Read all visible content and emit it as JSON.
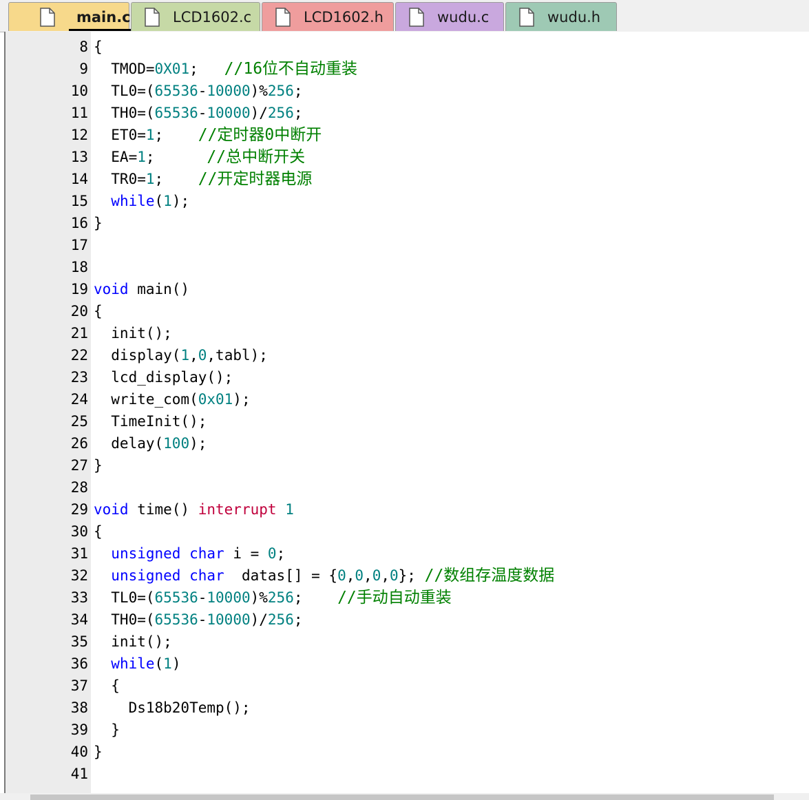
{
  "tabs": [
    {
      "label": "main.c",
      "active": true,
      "color": "#f7d98b"
    },
    {
      "label": "LCD1602.c",
      "active": false,
      "color": "#c6d9a6"
    },
    {
      "label": "LCD1602.h",
      "active": false,
      "color": "#ef9d9d"
    },
    {
      "label": "wudu.c",
      "active": false,
      "color": "#c9a8de"
    },
    {
      "label": "wudu.h",
      "active": false,
      "color": "#9ec9b4"
    }
  ],
  "tab_icon": "file-icon",
  "syntax_colors": {
    "keyword": "#0000ff",
    "number": "#008080",
    "interrupt": "#c0003c",
    "comment": "#008000",
    "text": "#000000"
  },
  "code_lines": [
    {
      "n": "8",
      "tokens": [
        {
          "t": "{"
        }
      ]
    },
    {
      "n": "9",
      "tokens": [
        {
          "t": "  TMOD="
        },
        {
          "t": "0X01",
          "c": "num"
        },
        {
          "t": ";   "
        },
        {
          "t": "//16位不自动重装",
          "c": "cm"
        }
      ]
    },
    {
      "n": "10",
      "tokens": [
        {
          "t": "  TL0=("
        },
        {
          "t": "65536",
          "c": "num"
        },
        {
          "t": "-"
        },
        {
          "t": "10000",
          "c": "num"
        },
        {
          "t": ")%"
        },
        {
          "t": "256",
          "c": "num"
        },
        {
          "t": ";"
        }
      ]
    },
    {
      "n": "11",
      "tokens": [
        {
          "t": "  TH0=("
        },
        {
          "t": "65536",
          "c": "num"
        },
        {
          "t": "-"
        },
        {
          "t": "10000",
          "c": "num"
        },
        {
          "t": ")/"
        },
        {
          "t": "256",
          "c": "num"
        },
        {
          "t": ";"
        }
      ]
    },
    {
      "n": "12",
      "tokens": [
        {
          "t": "  ET0="
        },
        {
          "t": "1",
          "c": "num"
        },
        {
          "t": ";    "
        },
        {
          "t": "//定时器0中断开",
          "c": "cm"
        }
      ]
    },
    {
      "n": "13",
      "tokens": [
        {
          "t": "  EA="
        },
        {
          "t": "1",
          "c": "num"
        },
        {
          "t": ";      "
        },
        {
          "t": "//总中断开关",
          "c": "cm"
        }
      ]
    },
    {
      "n": "14",
      "tokens": [
        {
          "t": "  TR0="
        },
        {
          "t": "1",
          "c": "num"
        },
        {
          "t": ";    "
        },
        {
          "t": "//开定时器电源",
          "c": "cm"
        }
      ]
    },
    {
      "n": "15",
      "tokens": [
        {
          "t": "  "
        },
        {
          "t": "while",
          "c": "kw"
        },
        {
          "t": "("
        },
        {
          "t": "1",
          "c": "num"
        },
        {
          "t": ");"
        }
      ]
    },
    {
      "n": "16",
      "tokens": [
        {
          "t": "}"
        }
      ]
    },
    {
      "n": "17",
      "tokens": []
    },
    {
      "n": "18",
      "tokens": []
    },
    {
      "n": "19",
      "tokens": [
        {
          "t": "void",
          "c": "kw"
        },
        {
          "t": " main()"
        }
      ]
    },
    {
      "n": "20",
      "tokens": [
        {
          "t": "{"
        }
      ]
    },
    {
      "n": "21",
      "tokens": [
        {
          "t": "  init();"
        }
      ]
    },
    {
      "n": "22",
      "tokens": [
        {
          "t": "  display("
        },
        {
          "t": "1",
          "c": "num"
        },
        {
          "t": ","
        },
        {
          "t": "0",
          "c": "num"
        },
        {
          "t": ",tabl);"
        }
      ]
    },
    {
      "n": "23",
      "tokens": [
        {
          "t": "  lcd_display();"
        }
      ]
    },
    {
      "n": "24",
      "tokens": [
        {
          "t": "  write_com("
        },
        {
          "t": "0x01",
          "c": "num"
        },
        {
          "t": ");"
        }
      ]
    },
    {
      "n": "25",
      "tokens": [
        {
          "t": "  TimeInit();"
        }
      ]
    },
    {
      "n": "26",
      "tokens": [
        {
          "t": "  delay("
        },
        {
          "t": "100",
          "c": "num"
        },
        {
          "t": ");"
        }
      ]
    },
    {
      "n": "27",
      "tokens": [
        {
          "t": "}"
        }
      ]
    },
    {
      "n": "28",
      "tokens": []
    },
    {
      "n": "29",
      "tokens": [
        {
          "t": "void",
          "c": "kw"
        },
        {
          "t": " time() "
        },
        {
          "t": "interrupt",
          "c": "int"
        },
        {
          "t": " "
        },
        {
          "t": "1",
          "c": "num"
        }
      ]
    },
    {
      "n": "30",
      "tokens": [
        {
          "t": "{"
        }
      ]
    },
    {
      "n": "31",
      "tokens": [
        {
          "t": "  "
        },
        {
          "t": "unsigned",
          "c": "kw"
        },
        {
          "t": " "
        },
        {
          "t": "char",
          "c": "kw"
        },
        {
          "t": " i = "
        },
        {
          "t": "0",
          "c": "num"
        },
        {
          "t": ";"
        }
      ]
    },
    {
      "n": "32",
      "tokens": [
        {
          "t": "  "
        },
        {
          "t": "unsigned",
          "c": "kw"
        },
        {
          "t": " "
        },
        {
          "t": "char",
          "c": "kw"
        },
        {
          "t": "  datas[] = {"
        },
        {
          "t": "0",
          "c": "num"
        },
        {
          "t": ","
        },
        {
          "t": "0",
          "c": "num"
        },
        {
          "t": ","
        },
        {
          "t": "0",
          "c": "num"
        },
        {
          "t": ","
        },
        {
          "t": "0",
          "c": "num"
        },
        {
          "t": "}; "
        },
        {
          "t": "//数组存温度数据",
          "c": "cm"
        }
      ]
    },
    {
      "n": "33",
      "tokens": [
        {
          "t": "  TL0=("
        },
        {
          "t": "65536",
          "c": "num"
        },
        {
          "t": "-"
        },
        {
          "t": "10000",
          "c": "num"
        },
        {
          "t": ")%"
        },
        {
          "t": "256",
          "c": "num"
        },
        {
          "t": ";    "
        },
        {
          "t": "//手动自动重装",
          "c": "cm"
        }
      ]
    },
    {
      "n": "34",
      "tokens": [
        {
          "t": "  TH0=("
        },
        {
          "t": "65536",
          "c": "num"
        },
        {
          "t": "-"
        },
        {
          "t": "10000",
          "c": "num"
        },
        {
          "t": ")/"
        },
        {
          "t": "256",
          "c": "num"
        },
        {
          "t": ";"
        }
      ]
    },
    {
      "n": "35",
      "tokens": [
        {
          "t": "  init();"
        }
      ]
    },
    {
      "n": "36",
      "tokens": [
        {
          "t": "  "
        },
        {
          "t": "while",
          "c": "kw"
        },
        {
          "t": "("
        },
        {
          "t": "1",
          "c": "num"
        },
        {
          "t": ")"
        }
      ]
    },
    {
      "n": "37",
      "tokens": [
        {
          "t": "  {"
        }
      ]
    },
    {
      "n": "38",
      "tokens": [
        {
          "t": "    Ds18b20Temp();"
        }
      ]
    },
    {
      "n": "39",
      "tokens": [
        {
          "t": "  }"
        }
      ]
    },
    {
      "n": "40",
      "tokens": [
        {
          "t": "}"
        }
      ]
    },
    {
      "n": "41",
      "tokens": []
    }
  ]
}
